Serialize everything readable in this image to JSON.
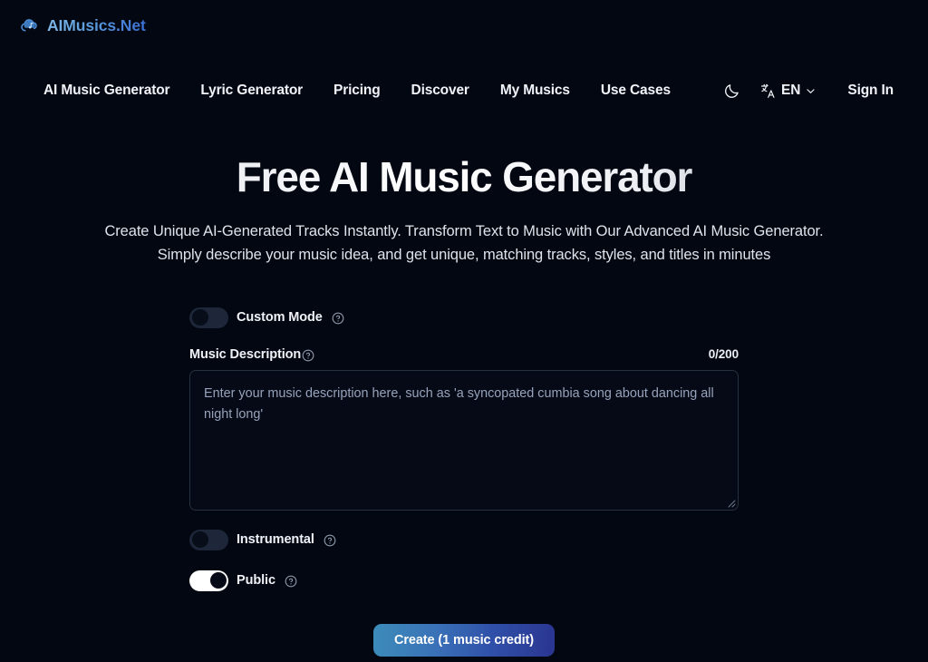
{
  "brand": {
    "name": "AIMusics.Net",
    "logo_icon": "cloud-music-note-icon",
    "accent_start": "#7fb8ea",
    "accent_end": "#3b6fd4"
  },
  "nav": {
    "links": [
      {
        "label": "AI Music Generator"
      },
      {
        "label": "Lyric Generator"
      },
      {
        "label": "Pricing"
      },
      {
        "label": "Discover"
      },
      {
        "label": "My Musics"
      },
      {
        "label": "Use Cases"
      }
    ],
    "theme_toggle_icon": "moon-icon",
    "language": {
      "icon": "translate-icon",
      "value": "EN",
      "chevron": "chevron-down-icon"
    },
    "sign_in": "Sign In"
  },
  "hero": {
    "title": "Free AI Music Generator",
    "subtitle": "Create Unique AI-Generated Tracks Instantly. Transform Text to Music with Our Advanced AI Music Generator. Simply describe your music idea, and get unique, matching tracks, styles, and titles in minutes"
  },
  "form": {
    "custom_mode": {
      "label": "Custom Mode",
      "state": "off",
      "help_icon": "help-circle-icon"
    },
    "music_description": {
      "label": "Music Description",
      "help_icon": "help-circle-icon",
      "counter": "0/200",
      "value": "",
      "placeholder": "Enter your music description here, such as 'a syncopated cumbia song about dancing all night long'"
    },
    "instrumental": {
      "label": "Instrumental",
      "state": "off",
      "help_icon": "help-circle-icon"
    },
    "public": {
      "label": "Public",
      "state": "on",
      "help_icon": "help-circle-icon"
    },
    "create_button": {
      "label": "Create (1 music credit)",
      "gradient_start": "#3c8cb9",
      "gradient_end": "#2a3590"
    }
  }
}
